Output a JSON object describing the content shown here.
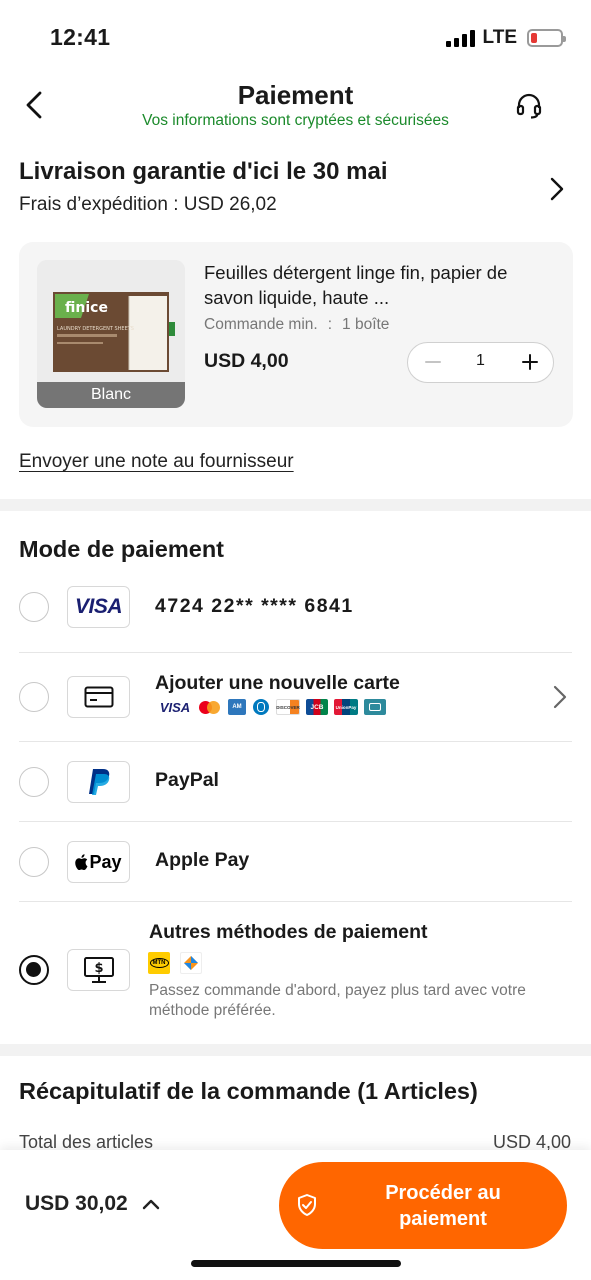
{
  "status_bar": {
    "time": "12:41",
    "network": "LTE"
  },
  "header": {
    "title": "Paiement",
    "subtitle": "Vos informations sont cryptées et sécurisées"
  },
  "delivery": {
    "title": "Livraison garantie d'ici le 30 mai",
    "fee": "Frais d’expédition : USD 26,02"
  },
  "product": {
    "name": "Feuilles détergent linge fin, papier de savon liquide, haute ...",
    "min_order_label": "Commande min.",
    "min_order_sep": ":",
    "min_order_value": "1 boîte",
    "price": "USD 4,00",
    "quantity": "1",
    "variant": "Blanc",
    "image_brand": "finice",
    "image_caption": "LAUNDRY DETERGENT SHEETS"
  },
  "note_link": "Envoyer une note au fournisseur",
  "payment": {
    "title": "Mode de paiement",
    "saved_card": {
      "brand": "VISA",
      "number": "4724  22**  ****  6841"
    },
    "new_card": {
      "label": "Ajouter une nouvelle carte",
      "brands": [
        "VISA",
        "mastercard-icon",
        "amex-icon",
        "diners-icon",
        "DISCOVER",
        "JCB",
        "UnionPay",
        "card-icon"
      ]
    },
    "paypal": {
      "label": "PayPal"
    },
    "apple_pay": {
      "label": "Apple Pay",
      "icon_text": "Pay"
    },
    "other": {
      "label": "Autres méthodes de paiement",
      "description": "Passez commande d'abord, payez plus tard avec votre méthode préférée.",
      "badge_text": "MTN"
    }
  },
  "summary": {
    "title": "Récapitulatif de la commande (1 Articles)",
    "items_label": "Total des articles",
    "items_value": "USD 4,00"
  },
  "bottom": {
    "total": "USD 30,02",
    "checkout_line1": "Procéder au",
    "checkout_line2": "paiement"
  },
  "colors": {
    "accent": "#ff6600",
    "secure_text": "#1b8a2b",
    "visa_blue": "#1a1f71",
    "paypal_blue": "#003087"
  }
}
